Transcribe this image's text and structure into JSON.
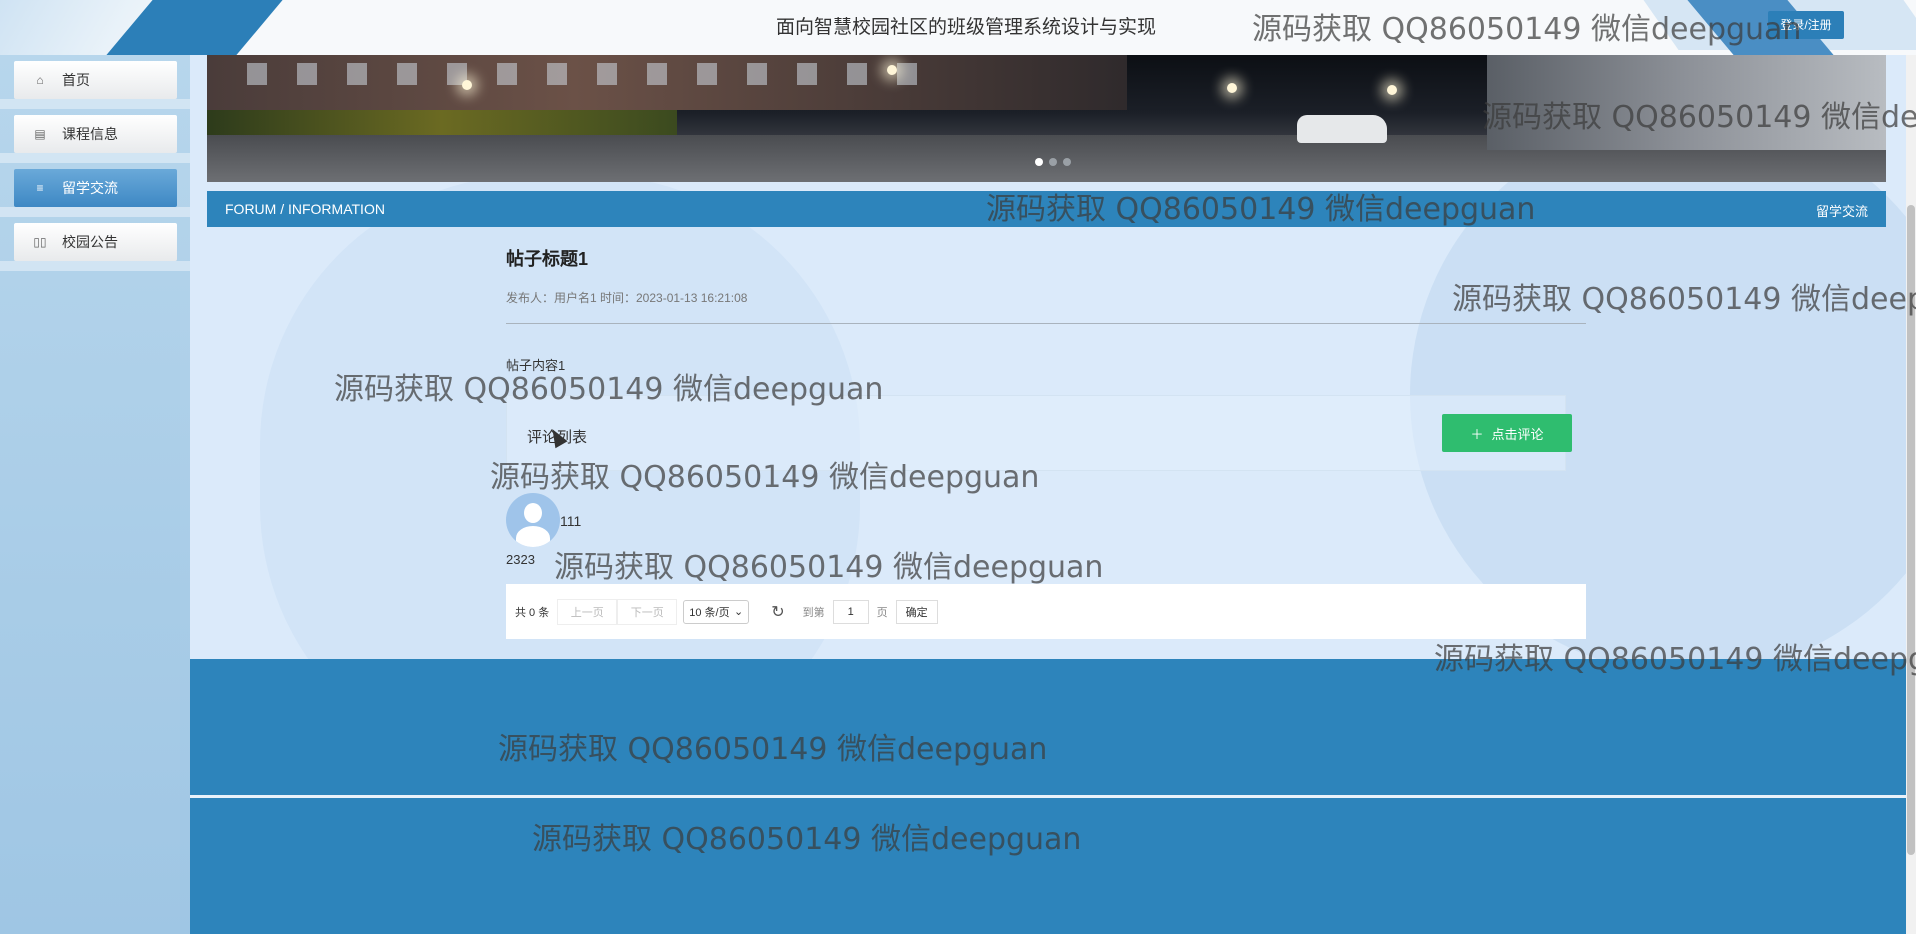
{
  "header": {
    "site_title": "面向智慧校园社区的班级管理系统设计与实现",
    "login_label": "登录/注册"
  },
  "sidebar": {
    "items": [
      {
        "label": "首页",
        "icon": "home-icon"
      },
      {
        "label": "课程信息",
        "icon": "document-icon"
      },
      {
        "label": "留学交流",
        "icon": "list-icon"
      },
      {
        "label": "校园公告",
        "icon": "book-icon"
      }
    ],
    "active_index": 2
  },
  "section": {
    "left_label": "FORUM / INFORMATION",
    "right_label": "留学交流"
  },
  "post": {
    "title": "帖子标题1",
    "meta": "发布人：用户名1 时间：2023-01-13 16:21:08",
    "content": "帖子内容1"
  },
  "comments": {
    "heading": "评论列表",
    "add_button": "点击评论",
    "items": [
      {
        "user": "111",
        "text": "2323"
      }
    ]
  },
  "pager": {
    "total": "共 0 条",
    "prev": "上一页",
    "next": "下一页",
    "page_size": "10 条/页",
    "goto_label": "到第",
    "page_value": "1",
    "page_unit": "页",
    "confirm": "确定"
  },
  "carousel": {
    "slides": 3,
    "active": 0
  },
  "watermark": "源码获取 QQ86050149 微信deepguan",
  "colors": {
    "primary": "#2d84bb",
    "accent_green": "#2fbd6f"
  }
}
